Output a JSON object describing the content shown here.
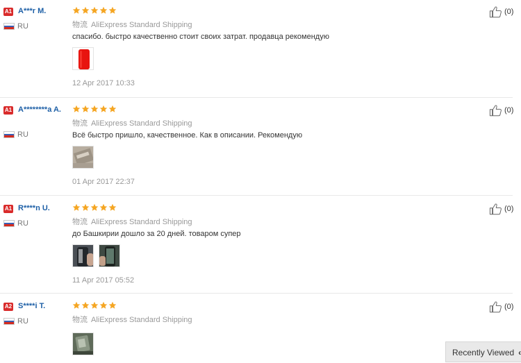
{
  "reviews": [
    {
      "badge": "A1",
      "user": "A***r M.",
      "country": "RU",
      "logistics_label": "物流",
      "shipping": "AliExpress Standard Shipping",
      "comment": "спасибо. быстро качественно стоит своих затрат. продавца рекомендую",
      "date": "12 Apr 2017 10:33",
      "helpful": "(0)",
      "rating": 5
    },
    {
      "badge": "A1",
      "user": "A********a A.",
      "country": "RU",
      "logistics_label": "物流",
      "shipping": "AliExpress Standard Shipping",
      "comment": "Всё быстро пришло, качественное. Как в описании. Рекомендую",
      "date": "01 Apr 2017 22:37",
      "helpful": "(0)",
      "rating": 5
    },
    {
      "badge": "A1",
      "user": "R****n U.",
      "country": "RU",
      "logistics_label": "物流",
      "shipping": "AliExpress Standard Shipping",
      "comment": "до Башкирии дошло за 20 дней. товаром супер",
      "date": "11 Apr 2017 05:52",
      "helpful": "(0)",
      "rating": 5
    },
    {
      "badge": "A2",
      "user": "S****i T.",
      "country": "RU",
      "logistics_label": "物流",
      "shipping": "AliExpress Standard Shipping",
      "comment": "",
      "date": "",
      "helpful": "(0)",
      "rating": 5
    }
  ],
  "recently_viewed": "Recently Viewed",
  "colors": {
    "star": "#f5a623",
    "username": "#1d5fa6",
    "badge": "#d92b2b"
  },
  "icons": {
    "rating": "star-icon",
    "helpful": "thumbs-up-icon",
    "flag": "russia-flag-icon"
  }
}
